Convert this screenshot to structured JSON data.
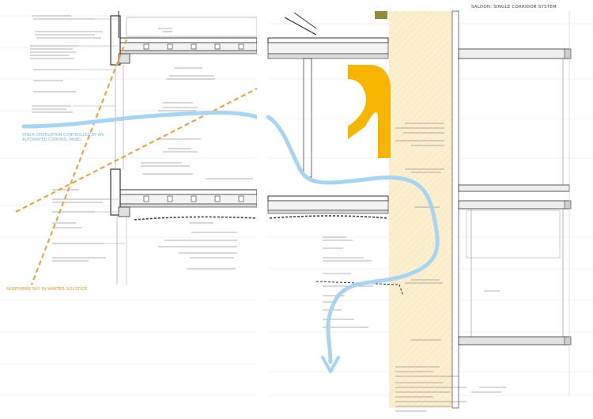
{
  "sheet": {
    "title": "SALOON: SINGLE CORRIDOR SYSTEM",
    "blue_label": "STACK VENTILATION CONTROLLED BY AN AUTOMATED CONTROL PANEL",
    "orange_label": "NORTHERN SKY IN WINTER SOLSTICE"
  },
  "colors": {
    "blue_airflow": "#a8d4f2",
    "orange_sunline": "#f29a3a",
    "yellow_panel": "#f7b500",
    "cream_wall": "#fbefcf",
    "line": "#333333"
  },
  "icons": [
    "airflow-arrow-icon"
  ]
}
